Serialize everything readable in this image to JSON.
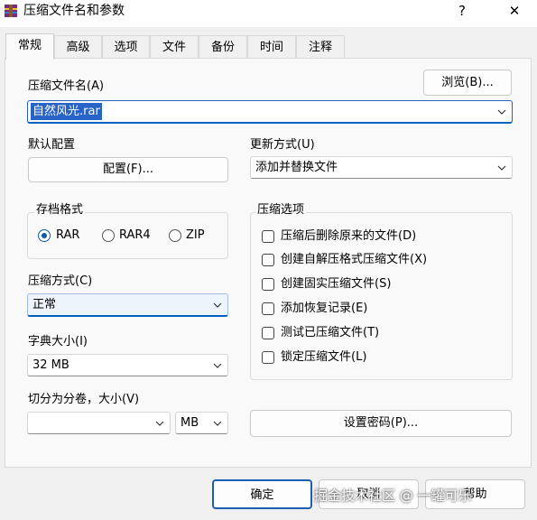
{
  "window": {
    "title": "压缩文件名和参数",
    "help": "?",
    "close": "✕"
  },
  "tabs": [
    "常规",
    "高级",
    "选项",
    "文件",
    "备份",
    "时间",
    "注释"
  ],
  "archive": {
    "label": "压缩文件名(A)",
    "value": "自然风光.rar",
    "browse_label": "浏览(B)..."
  },
  "profile": {
    "label": "默认配置",
    "button_label": "配置(F)..."
  },
  "update": {
    "label": "更新方式(U)",
    "value": "添加并替换文件"
  },
  "format": {
    "label": "存档格式",
    "options": [
      "RAR",
      "RAR4",
      "ZIP"
    ],
    "selected": "RAR"
  },
  "options": {
    "label": "压缩选项",
    "items": [
      {
        "label": "压缩后删除原来的文件(D)",
        "checked": false
      },
      {
        "label": "创建自解压格式压缩文件(X)",
        "checked": false
      },
      {
        "label": "创建固实压缩文件(S)",
        "checked": false
      },
      {
        "label": "添加恢复记录(E)",
        "checked": false
      },
      {
        "label": "测试已压缩文件(T)",
        "checked": false
      },
      {
        "label": "锁定压缩文件(L)",
        "checked": false
      }
    ]
  },
  "method": {
    "label": "压缩方式(C)",
    "value": "正常"
  },
  "dictionary": {
    "label": "字典大小(I)",
    "value": "32 MB"
  },
  "split": {
    "label": "切分为分卷，大小(V)",
    "value": "",
    "unit": "MB"
  },
  "password_label": "设置密码(P)...",
  "footer": {
    "ok_label": "确定",
    "cancel_label": "取消",
    "help_label": "帮助"
  },
  "watermark": "掘金技术社区 @ 一罐可乐",
  "colors": {
    "accent": "#0b5cad",
    "selection": "#2864c8"
  }
}
